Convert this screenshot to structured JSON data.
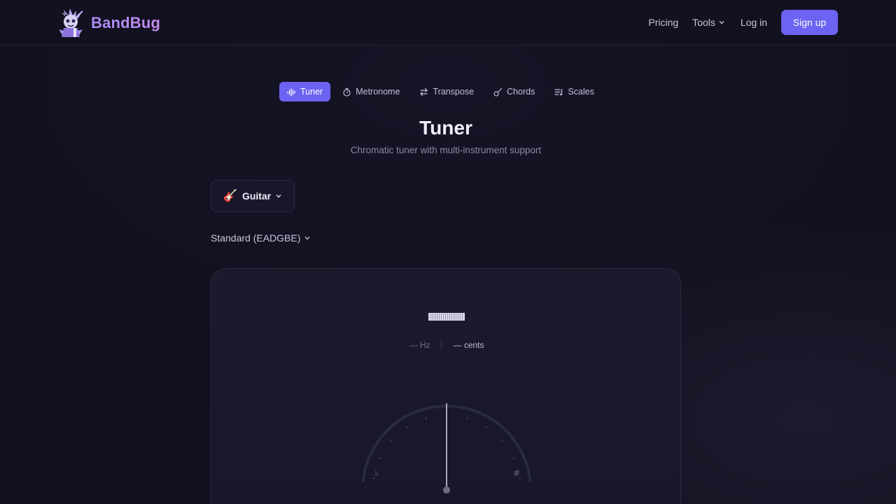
{
  "brand": {
    "name": "BandBug"
  },
  "nav": {
    "pricing": "Pricing",
    "tools": "Tools",
    "login": "Log in",
    "signup": "Sign up"
  },
  "tabs": [
    {
      "label": "Tuner",
      "icon": "waveform-icon",
      "active": true
    },
    {
      "label": "Metronome",
      "icon": "stopwatch-icon",
      "active": false
    },
    {
      "label": "Transpose",
      "icon": "swap-arrows-icon",
      "active": false
    },
    {
      "label": "Chords",
      "icon": "guitar-icon",
      "active": false
    },
    {
      "label": "Scales",
      "icon": "list-music-icon",
      "active": false
    }
  ],
  "page": {
    "title": "Tuner",
    "subtitle": "Chromatic tuner with multi-instrument support"
  },
  "instrument": {
    "emoji": "🎸",
    "label": "Guitar"
  },
  "tuning": {
    "label": "Standard (EADGBE)"
  },
  "tuner": {
    "hz": "— Hz",
    "cents": "— cents",
    "flat_symbol": "♭",
    "sharp_symbol": "#"
  },
  "colors": {
    "accent": "#6c63f2",
    "background": "#121120",
    "panel": "#1b1a2c"
  }
}
